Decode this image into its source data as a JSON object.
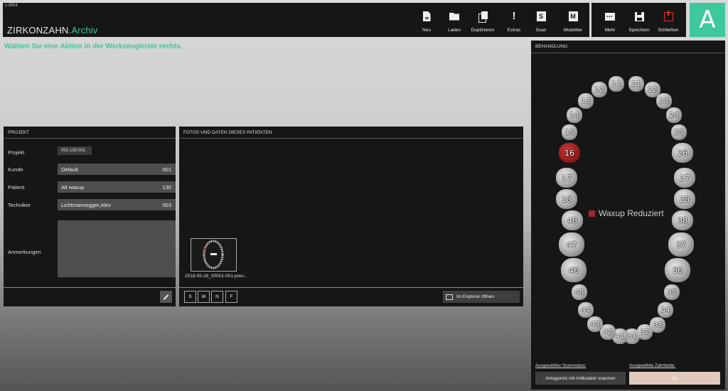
{
  "version": "v.3954",
  "app": {
    "brand": "ZIRKONZAHN",
    "module": "Archiv",
    "tile_letter": "A"
  },
  "toolbar": {
    "main": [
      {
        "label": "Neu",
        "icon": "new-document-icon"
      },
      {
        "label": "Laden",
        "icon": "folder-icon"
      },
      {
        "label": "Duplizieren",
        "icon": "duplicate-icon"
      },
      {
        "label": "Extras",
        "icon": "exclamation-icon"
      },
      {
        "label": "Scan",
        "icon": "scan-s-icon"
      },
      {
        "label": "Modellier",
        "icon": "model-m-icon"
      }
    ],
    "secondary": [
      {
        "label": "Mehr",
        "icon": "more-icon"
      },
      {
        "label": "Speichern",
        "icon": "save-icon"
      },
      {
        "label": "Schließen",
        "icon": "close-power-icon"
      }
    ]
  },
  "hint": "Wählen Sie eine Aktion in der Werkzeugleiste rechts.",
  "projekt": {
    "title": "PROJEKT",
    "projekt_label": "Projekt",
    "projekt_value": "001-130-001",
    "kunde_label": "Kunde",
    "kunde_value": "Default",
    "kunde_code": "001",
    "patient_label": "Patient",
    "patient_value": "Alt waxup",
    "patient_code": "130",
    "techniker_label": "Techniker",
    "techniker_value": "Lichtmannegger,Alex",
    "techniker_code": "003",
    "anmerkungen_label": "Anmerkungen",
    "anmerkungen_value": ""
  },
  "fotos": {
    "title": "FOTOS UND DATEN DIESES PATIENTEN",
    "thumbnail_label": "2018-05-28_00001-001-prev...",
    "filters": [
      "S",
      "M",
      "N",
      "F"
    ],
    "explorer_label": "Im Explorer öffnen"
  },
  "behandlung": {
    "title": "BEHANDLUNG",
    "legend": "Waxup Reduziert",
    "legend_color": "#a02828",
    "selected_tooth": "16",
    "teeth": [
      "11",
      "12",
      "13",
      "14",
      "15",
      "16",
      "17",
      "18",
      "21",
      "22",
      "23",
      "24",
      "25",
      "26",
      "27",
      "28",
      "31",
      "32",
      "33",
      "34",
      "35",
      "36",
      "37",
      "38",
      "41",
      "42",
      "43",
      "44",
      "45",
      "46",
      "47",
      "48"
    ],
    "scanmode_label": "Ausgewählter Scanmodus:",
    "scanmode_value": "Antagonist mit Artikulator scannen",
    "color_label": "Ausgewählte Zahnfarbe:",
    "color_value": "A1"
  },
  "accent_color": "#3dc89e"
}
